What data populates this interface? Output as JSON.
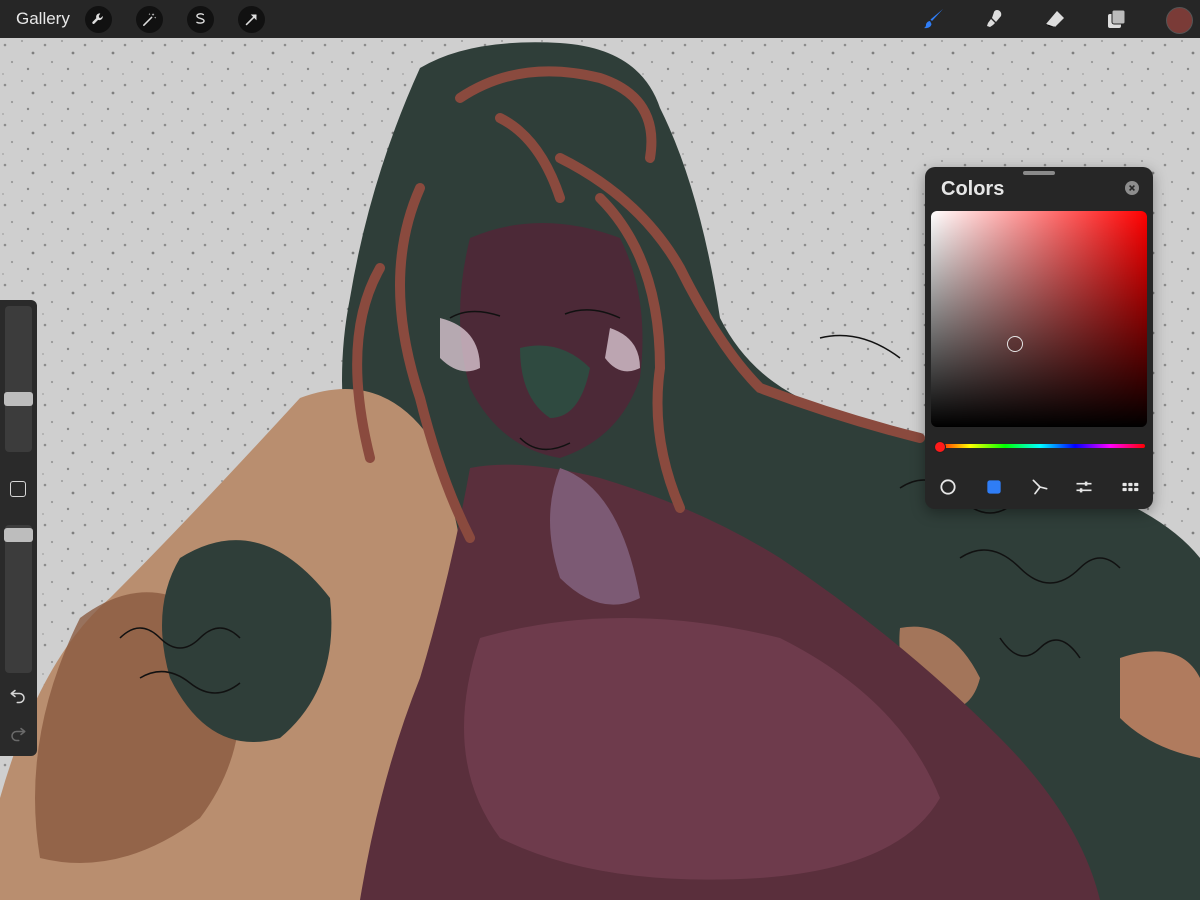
{
  "toolbar": {
    "gallery_label": "Gallery",
    "left_tools": [
      "wrench-icon",
      "magic-wand-icon",
      "selection-icon",
      "transform-arrow-icon"
    ],
    "right_tools": [
      "brush-icon",
      "smudge-icon",
      "eraser-icon",
      "layers-icon"
    ],
    "active_tool": "brush-icon",
    "active_color": "#7a3b37"
  },
  "sidebar": {
    "brush_size": 0.28,
    "opacity": 0.05,
    "icons": [
      "modify-square-icon",
      "undo-icon",
      "redo-icon"
    ]
  },
  "colors_panel": {
    "title": "Colors",
    "selected_mode": "disc",
    "hue_color": "#ff0000",
    "modes": [
      "disc-icon",
      "classic-square-icon",
      "harmony-icon",
      "value-sliders-icon",
      "palettes-grid-icon"
    ]
  }
}
